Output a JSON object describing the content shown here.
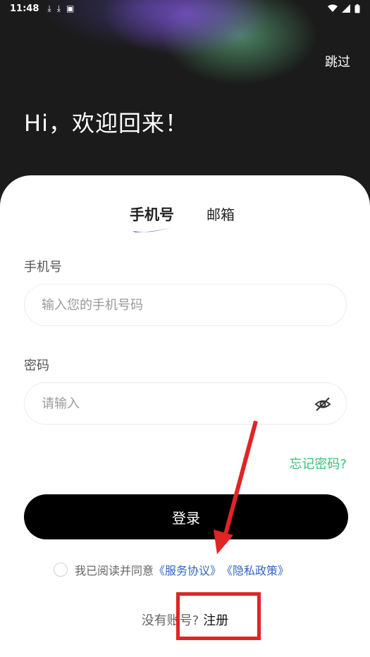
{
  "status_bar": {
    "time": "11:48",
    "left_icons": [
      "download-icon",
      "download-icon",
      "app-icon"
    ],
    "right_icons": [
      "wifi-icon",
      "signal-icon",
      "battery-icon"
    ]
  },
  "header": {
    "skip_label": "跳过",
    "welcome_text": "Hi，欢迎回来！"
  },
  "tabs": [
    {
      "label": "手机号",
      "active": true
    },
    {
      "label": "邮箱",
      "active": false
    }
  ],
  "form": {
    "phone_label": "手机号",
    "phone_placeholder": "输入您的手机号码",
    "password_label": "密码",
    "password_placeholder": "请输入",
    "forgot_label": "忘记密码?",
    "login_label": "登录"
  },
  "agreement": {
    "text": "我已阅读并同意",
    "service_link": "《服务协议》",
    "privacy_link": "《隐私政策》"
  },
  "signup": {
    "prompt": "没有账号?",
    "link": "注册"
  },
  "colors": {
    "accent_green": "#37c178",
    "link_blue": "#2f66c7",
    "annotation_red": "#e12424"
  }
}
